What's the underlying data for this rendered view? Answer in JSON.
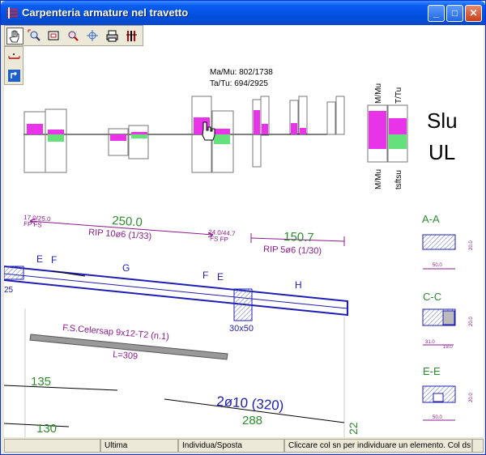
{
  "window": {
    "title": "Carpenteria armature nel travetto"
  },
  "toolbar": {
    "tools": [
      "hand-pan-tool",
      "zoom-extents-tool",
      "zoom-window-tool",
      "zoom-magnify-tool",
      "crosshair-pan-tool",
      "print-tool",
      "settings-tool"
    ]
  },
  "tooltip": {
    "line1": "Ma/Mu: 802/1738",
    "line2": "Ta/Tu: 694/2925"
  },
  "diagram_labels": {
    "left_top": "M/Mu",
    "right_top": "T/Tu",
    "left_bottom": "M/Mu",
    "right_bottom": "tsftsu"
  },
  "state": {
    "line1": "Slu",
    "line2": "UL"
  },
  "rebars": {
    "left_end": "17.0/25.0",
    "left_codes": "FP FS",
    "top_length": "250.0",
    "top_desc": "RIP 10ø6 (1/33)",
    "mid_end": "24.0/44.7",
    "mid_codes": "FS FP",
    "right_length": "150.7",
    "right_desc": "RIP 5ø6 (1/30)",
    "bottom_bar": "2ø10 (320)",
    "dim_135": "135",
    "dim_130": "130",
    "dim_288": "288",
    "dim_22": "22",
    "dim_25": "25"
  },
  "beam": {
    "section_points": [
      "E",
      "F",
      "G",
      "F",
      "E",
      "H"
    ],
    "column_size": "30x50",
    "joist_name": "F.S.Celersap 9x12-T2 (n.1)",
    "joist_length": "L=309"
  },
  "sections": [
    {
      "name": "A-A",
      "width": "50.0",
      "height": "20.0"
    },
    {
      "name": "C-C",
      "width": "31.0",
      "width2": "19.0",
      "height": "20.0"
    },
    {
      "name": "E-E",
      "width": "50.0",
      "height": "20.0"
    }
  ],
  "status": {
    "c1": "",
    "c2": "Ultima",
    "c3": "Individua/Sposta",
    "c4": "Cliccare col sn per individuare un elemento. Col ds"
  },
  "colors": {
    "magenta": "#E833E8",
    "green": "#66E07A",
    "blue_rebar": "#1E1EB4",
    "purple": "#8B1A8B",
    "green_text": "#2E8B2E"
  }
}
